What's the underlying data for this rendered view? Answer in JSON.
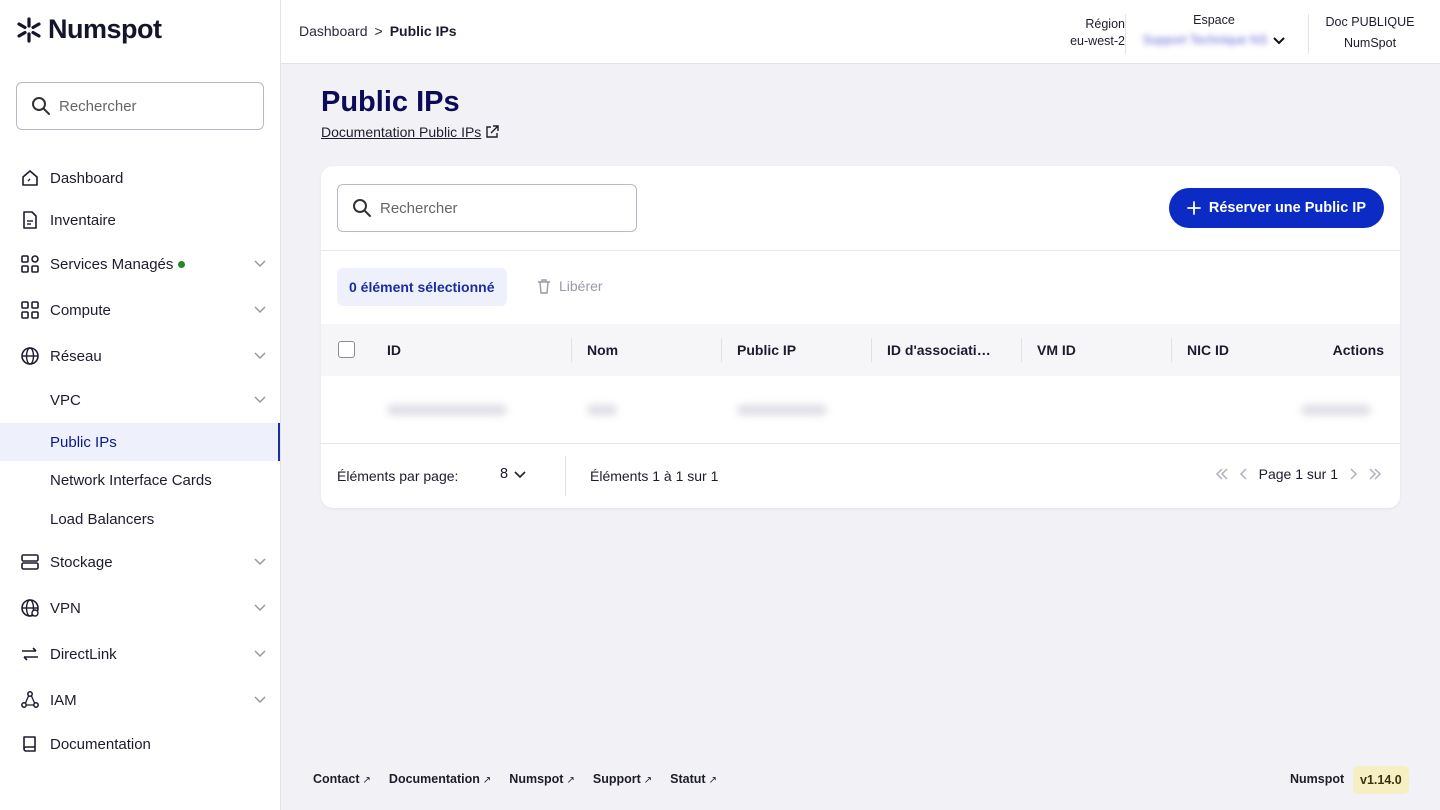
{
  "brand": {
    "name": "Numspot"
  },
  "sidebar": {
    "search_placeholder": "Rechercher",
    "items": [
      {
        "label": "Dashboard",
        "icon": "home-icon"
      },
      {
        "label": "Inventaire",
        "icon": "document-icon"
      },
      {
        "label": "Services Managés",
        "icon": "services-icon",
        "badge": "online",
        "expandable": true
      },
      {
        "label": "Compute",
        "icon": "grid-icon",
        "expandable": true
      },
      {
        "label": "Réseau",
        "icon": "globe-icon",
        "expandable": true,
        "expanded": true
      },
      {
        "label": "VPC",
        "sub": true,
        "expandable": true
      },
      {
        "label": "Public IPs",
        "sub": true,
        "active": true
      },
      {
        "label": "Network Interface Cards",
        "sub": true
      },
      {
        "label": "Load Balancers",
        "sub": true
      },
      {
        "label": "Stockage",
        "icon": "storage-icon",
        "expandable": true
      },
      {
        "label": "VPN",
        "icon": "vpn-globe-icon",
        "expandable": true
      },
      {
        "label": "DirectLink",
        "icon": "directlink-icon",
        "expandable": true
      },
      {
        "label": "IAM",
        "icon": "iam-icon",
        "expandable": true
      },
      {
        "label": "Documentation",
        "icon": "book-icon"
      }
    ]
  },
  "topbar": {
    "breadcrumb": {
      "parent": "Dashboard",
      "separator": ">",
      "current": "Public IPs"
    },
    "region": {
      "label": "Région",
      "value": "eu-west-2"
    },
    "espace": {
      "label": "Espace",
      "value": "Support Technique NS"
    },
    "doc": {
      "label": "Doc PUBLIQUE",
      "org": "NumSpot"
    }
  },
  "page": {
    "title": "Public IPs",
    "doc_link": "Documentation Public IPs"
  },
  "card": {
    "search_placeholder": "Rechercher",
    "primary_button": "Réserver une Public IP",
    "selected_text": "0 élément sélectionné",
    "release_label": "Libérer",
    "columns": [
      "ID",
      "Nom",
      "Public IP",
      "ID d'associati…",
      "VM ID",
      "NIC ID",
      "Actions"
    ],
    "pagination": {
      "per_page_label": "Éléments par page:",
      "per_page_value": "8",
      "range_text": "Éléments 1 à 1 sur 1",
      "page_text": "Page 1 sur 1"
    }
  },
  "footer": {
    "links": [
      "Contact",
      "Documentation",
      "Numspot",
      "Support",
      "Statut"
    ],
    "brand": "Numspot",
    "version": "v1.14.0"
  },
  "colors": {
    "accent": "#0b2bc4",
    "title": "#0b0b5a",
    "active_bg": "#eef0fb",
    "status_green": "#1a8a2a",
    "version_bg": "#f7efc4"
  }
}
